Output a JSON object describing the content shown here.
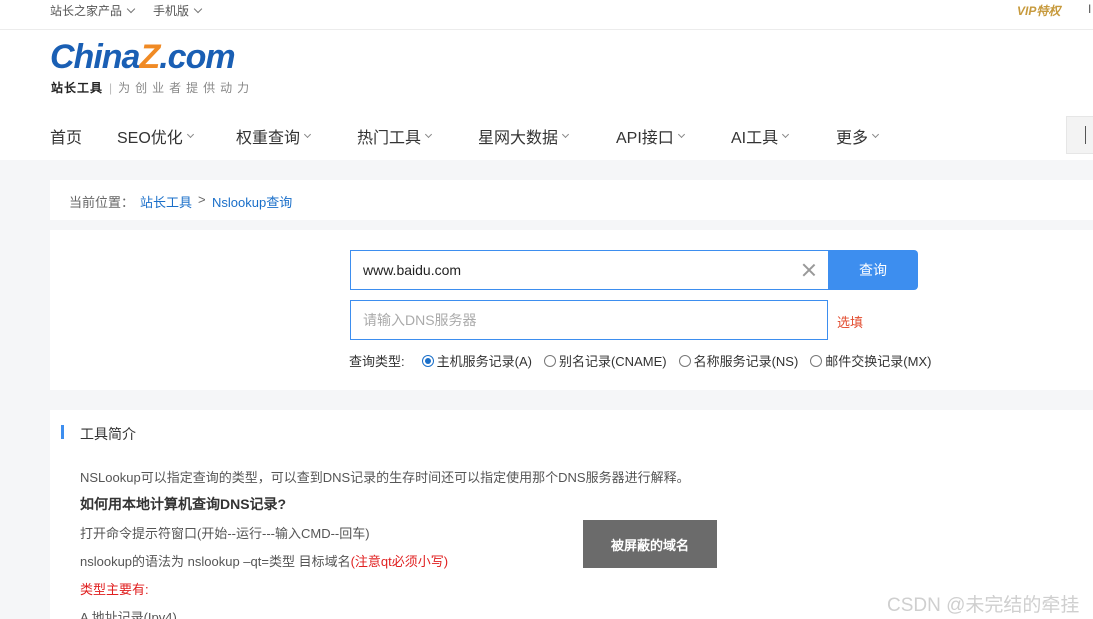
{
  "topbar": {
    "products": "站长之家产品",
    "mobile": "手机版",
    "vip": "VIP特权",
    "right_cut": "I"
  },
  "logo": {
    "part1": "China",
    "part2": "Z",
    "part3": ".com",
    "brand": "站长工具",
    "slogan": "为创业者提供动力"
  },
  "nav": {
    "items": [
      {
        "label": "首页"
      },
      {
        "label": "SEO优化"
      },
      {
        "label": "权重查询"
      },
      {
        "label": "热门工具"
      },
      {
        "label": "星网大数据"
      },
      {
        "label": "API接口"
      },
      {
        "label": "AI工具"
      },
      {
        "label": "更多"
      }
    ]
  },
  "breadcrumb": {
    "label": "当前位置：",
    "link1": "站长工具",
    "sep": ">",
    "link2": "Nslookup查询"
  },
  "query": {
    "domain_value": "www.baidu.com",
    "query_button": "查询",
    "dns_placeholder": "请输入DNS服务器",
    "optional_label": "选填",
    "type_label": "查询类型:",
    "types": [
      {
        "label": "主机服务记录(A)",
        "checked": true
      },
      {
        "label": "别名记录(CNAME)",
        "checked": false
      },
      {
        "label": "名称服务记录(NS)",
        "checked": false
      },
      {
        "label": "邮件交换记录(MX)",
        "checked": false
      }
    ]
  },
  "intro": {
    "title": "工具简介",
    "p1": "NSLookup可以指定查询的类型，可以查到DNS记录的生存时间还可以指定使用那个DNS服务器进行解释。",
    "p2": "如何用本地计算机查询DNS记录?",
    "p3": "打开命令提示符窗口(开始--运行---输入CMD--回车)",
    "p4_main": "nslookup的语法为 nslookup –qt=类型 目标域名",
    "p4_note": "(注意qt必须小写)",
    "p5": "类型主要有:",
    "p6": "A 地址记录(Ipv4)"
  },
  "overlay": {
    "text": "被屏蔽的域名"
  },
  "watermark": "CSDN @未完结的牵挂",
  "colors": {
    "accent": "#3d8eef",
    "link": "#1a6fc9",
    "optional": "#e24b2e",
    "note_red": "#e02020",
    "vip_gold": "#c79a3d",
    "logo_blue": "#1a5fb4",
    "logo_orange": "#f08a24"
  }
}
